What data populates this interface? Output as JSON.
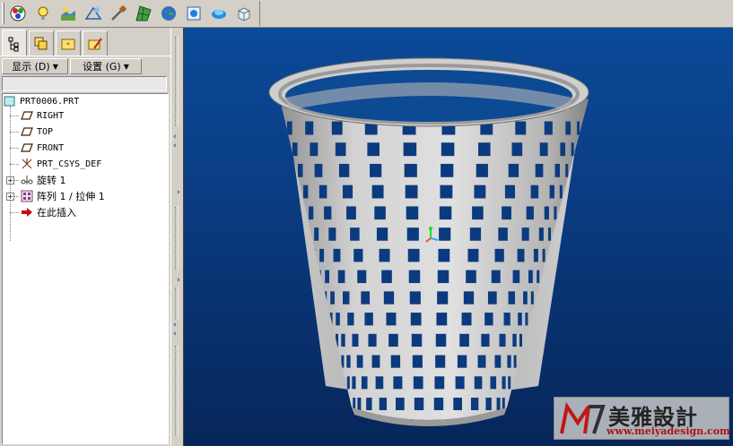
{
  "toolbar": {
    "icons": [
      "color-appearance-icon",
      "light-bulb-icon",
      "scene-icon",
      "perspective-icon",
      "model-tree-tools-icon",
      "mesh-icon",
      "globe-render-icon",
      "model-player-icon",
      "spin-icon",
      "solid-cube-icon"
    ]
  },
  "left_panel": {
    "tabs": [
      "model-tree-tab",
      "layers-tab",
      "favorites-tab",
      "tools-tab"
    ],
    "show_label": "显示 (D)",
    "settings_label": "设置 (G)",
    "filter_value": ""
  },
  "tree": {
    "root": "PRT0006.PRT",
    "items": [
      {
        "label": "RIGHT",
        "icon": "datum-plane-icon"
      },
      {
        "label": "TOP",
        "icon": "datum-plane-icon"
      },
      {
        "label": "FRONT",
        "icon": "datum-plane-icon"
      },
      {
        "label": "PRT_CSYS_DEF",
        "icon": "csys-icon"
      },
      {
        "label": "旋转 1",
        "icon": "revolve-icon"
      },
      {
        "label": "阵列 1 / 拉伸 1",
        "icon": "pattern-icon"
      },
      {
        "label": "在此插入",
        "icon": "insert-here-icon"
      }
    ]
  },
  "watermark": {
    "title": "美雅設計",
    "url": "www.meiyadesign.com"
  },
  "colors": {
    "viewport_top": "#0a4a98",
    "viewport_bottom": "#06265a",
    "model": "#c8c8c8",
    "watermark_url": "#b01010"
  }
}
